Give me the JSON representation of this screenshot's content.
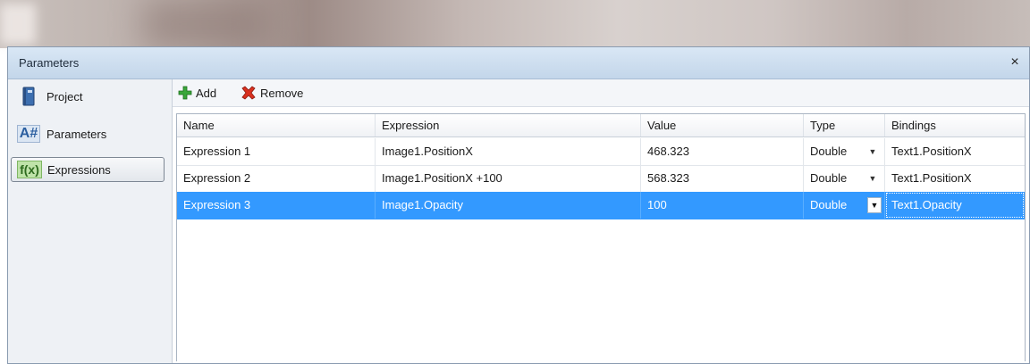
{
  "window": {
    "title": "Parameters",
    "close_glyph": "×"
  },
  "sidebar": {
    "items": [
      {
        "label": "Project",
        "icon": "project-book-icon"
      },
      {
        "label": "Parameters",
        "icon": "a-hash-icon",
        "icon_text": "A#"
      },
      {
        "label": "Expressions",
        "icon": "fx-icon",
        "icon_text": "f(x)",
        "selected": true
      }
    ]
  },
  "toolbar": {
    "add_label": "Add",
    "remove_label": "Remove"
  },
  "table": {
    "columns": [
      "Name",
      "Expression",
      "Value",
      "Type",
      "Bindings"
    ],
    "rows": [
      {
        "name": "Expression 1",
        "expression": "Image1.PositionX",
        "value": "468.323",
        "type": "Double",
        "binding": "Text1.PositionX"
      },
      {
        "name": "Expression 2",
        "expression": "Image1.PositionX +100",
        "value": "568.323",
        "type": "Double",
        "binding": "Text1.PositionX"
      },
      {
        "name": "Expression 3",
        "expression": "Image1.Opacity",
        "value": "100",
        "type": "Double",
        "binding": "Text1.Opacity",
        "selected": true
      }
    ]
  },
  "colors": {
    "selection": "#3399ff",
    "titlebar": "#c3d6ea",
    "add_green": "#3aa63a",
    "remove_red": "#d9301f"
  }
}
